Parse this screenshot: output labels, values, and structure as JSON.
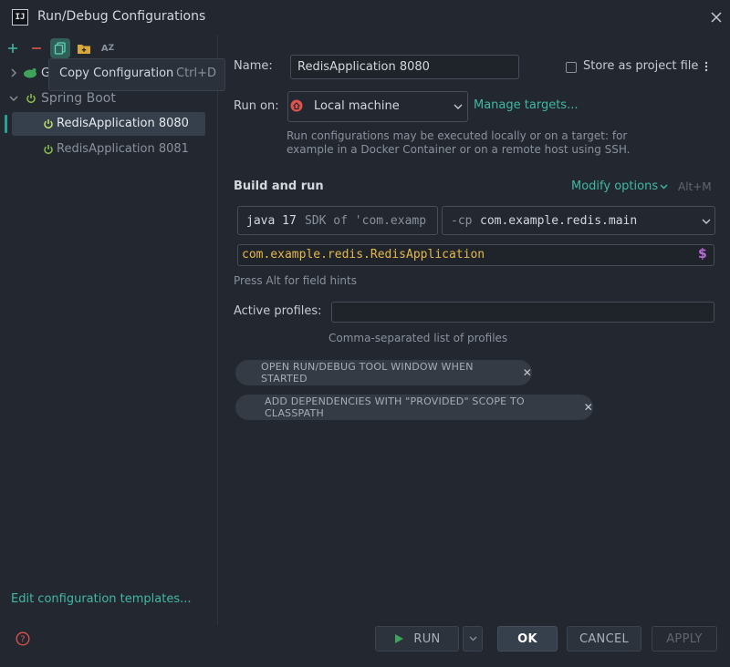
{
  "window": {
    "title": "Run/Debug Configurations"
  },
  "toolbar": {
    "items": [
      {
        "name": "add-icon",
        "glyph": "+"
      },
      {
        "name": "remove-icon",
        "glyph": "−"
      },
      {
        "name": "copy-icon",
        "glyph": "⧉"
      },
      {
        "name": "folder-icon",
        "glyph": "▣"
      },
      {
        "name": "sort-icon",
        "glyph": "AZ"
      }
    ]
  },
  "tooltip": {
    "label": "Copy Configuration",
    "shortcut": "Ctrl+D"
  },
  "tree": {
    "group_partial": "G",
    "spring_boot": "Spring Boot",
    "items": [
      {
        "label": "RedisApplication 8080"
      },
      {
        "label": "RedisApplication 8081"
      }
    ]
  },
  "left_footer": {
    "templates_link": "Edit configuration templates..."
  },
  "form": {
    "name_label": "Name:",
    "name_value": "RedisApplication 8080",
    "store_label": "Store as project file",
    "run_on_label": "Run on:",
    "run_on_value": "Local machine",
    "manage_targets": "Manage targets...",
    "run_on_hint_1": "Run configurations may be executed locally or on a target: for",
    "run_on_hint_2": "example in a Docker Container or on a remote host using SSH.",
    "build_and_run": "Build and run",
    "modify_options": "Modify options",
    "modify_shortcut": "Alt+M",
    "jdk_main": "java 17",
    "jdk_detail": "SDK of 'com.examp",
    "cp_flag": "-cp",
    "cp_value": "com.example.redis.main",
    "main_class": "com.example.redis.RedisApplication",
    "field_hint": "Press Alt for field hints",
    "profiles_label": "Active profiles:",
    "profiles_value": "",
    "profiles_hint": "Comma-separated list of profiles",
    "chips": [
      "OPEN RUN/DEBUG TOOL WINDOW WHEN STARTED",
      "ADD DEPENDENCIES WITH \"PROVIDED\" SCOPE TO CLASSPATH"
    ]
  },
  "buttons": {
    "run": "RUN",
    "ok": "OK",
    "cancel": "CANCEL",
    "apply": "APPLY"
  },
  "colors": {
    "accent": "#3fb8a4",
    "spring": "#8bc34a",
    "main_class": "#e6b84a",
    "selection": "#36404c"
  }
}
